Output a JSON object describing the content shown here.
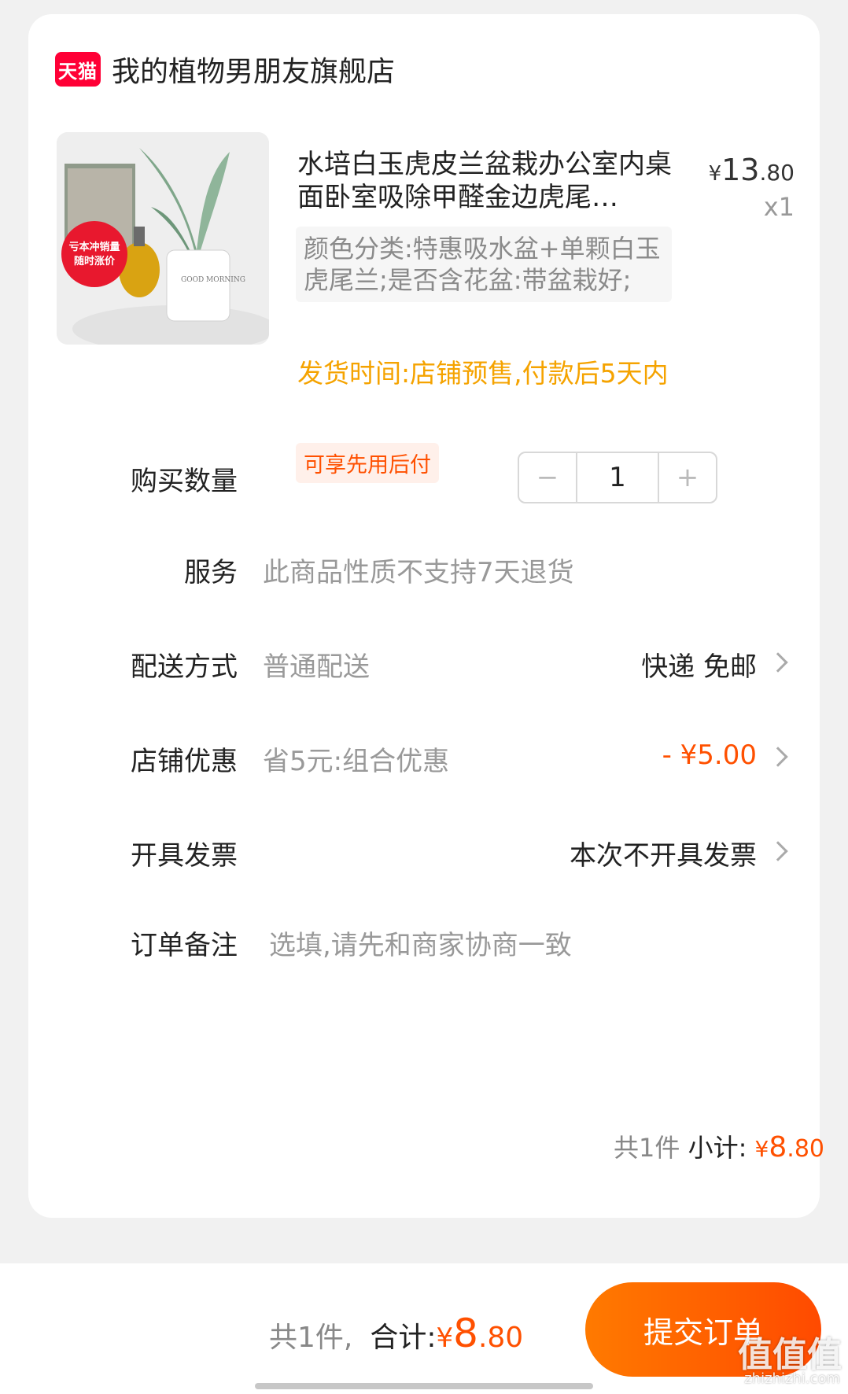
{
  "shop": {
    "badge": "天猫",
    "name": "我的植物男朋友旗舰店"
  },
  "product": {
    "title": "水培白玉虎皮兰盆栽办公室内桌面卧室吸除甲醛金边虎尾…",
    "price_symbol": "¥",
    "price_int": "13",
    "price_dec": ".80",
    "quantity_mark": "x1",
    "sku": "颜色分类:特惠吸水盆+单颗白玉虎尾兰;是否含花盆:带盆栽好;",
    "ship_time": "发货时间:店铺预售,付款后5天内",
    "tag": "可享先用后付",
    "image_sticker_line1": "亏本冲销量",
    "image_sticker_line2": "随时涨价",
    "image_pot_text": "GOOD MORNING"
  },
  "quantity": {
    "label": "购买数量",
    "minus": "−",
    "value": "1",
    "plus": "+"
  },
  "service": {
    "label": "服务",
    "value": "此商品性质不支持7天退货"
  },
  "delivery": {
    "label": "配送方式",
    "value": "普通配送",
    "right": "快递 免邮"
  },
  "discount": {
    "label": "店铺优惠",
    "value": "省5元:组合优惠",
    "right": "- ¥5.00"
  },
  "invoice": {
    "label": "开具发票",
    "right": "本次不开具发票"
  },
  "note": {
    "label": "订单备注",
    "placeholder": "选填,请先和商家协商一致"
  },
  "subtotal": {
    "count": "共1件",
    "label": "小计:",
    "symbol": "¥",
    "int": "8",
    "dec": ".80"
  },
  "footer": {
    "count": "共1件,",
    "label": "合计:",
    "symbol": "¥",
    "int": "8",
    "dec": ".80",
    "submit_label": "提交订单",
    "watermark": "值值值",
    "watermark_sub": "zhizhizhi.com"
  },
  "colors": {
    "accent": "#ff5000",
    "ship_time": "#f5a300",
    "tmall": "#ff0036"
  }
}
